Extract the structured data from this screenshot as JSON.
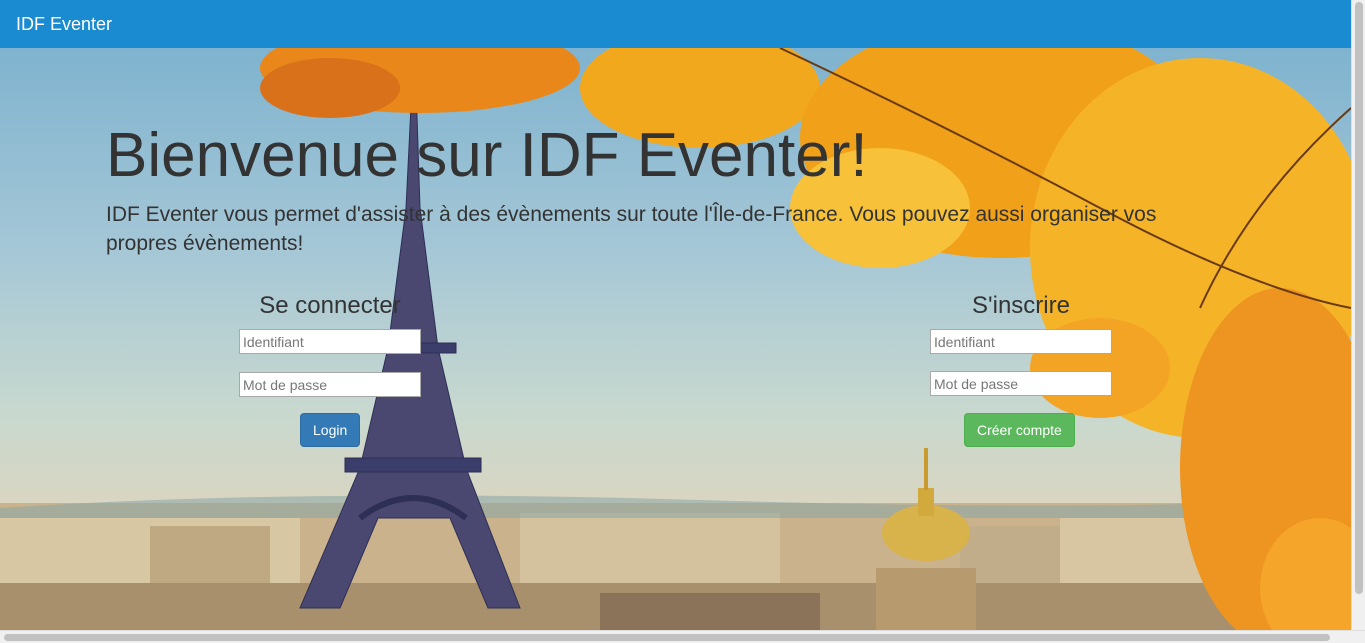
{
  "navbar": {
    "brand": "IDF Eventer"
  },
  "hero": {
    "title": "Bienvenue sur IDF Eventer!",
    "intro": "IDF Eventer vous permet d'assister à des évènements sur toute l'Île-de-France. Vous pouvez aussi organiser vos propres évènements!"
  },
  "login": {
    "title": "Se connecter",
    "username_placeholder": "Identifiant",
    "password_placeholder": "Mot de passe",
    "submit_label": "Login"
  },
  "signup": {
    "title": "S'inscrire",
    "username_placeholder": "Identifiant",
    "password_placeholder": "Mot de passe",
    "submit_label": "Créer compte"
  },
  "colors": {
    "navbar": "#1a8bd0",
    "login_button": "#337ab7",
    "signup_button": "#5cb85c"
  }
}
